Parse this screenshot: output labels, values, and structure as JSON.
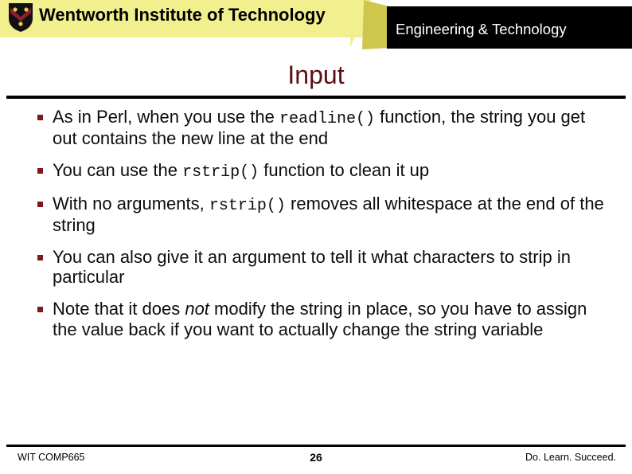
{
  "header": {
    "school_name": "Wentworth Institute of Technology",
    "department_name": "Engineering & Technology",
    "logo_alt": "wentworth-shield-crest",
    "colors": {
      "banner_yellow": "#f2ef8e",
      "banner_gold": "#cec74e",
      "banner_black": "#000000",
      "shield_black": "#111111",
      "shield_maroon": "#8e1f2d",
      "shield_gold": "#e6c84a"
    }
  },
  "slide": {
    "title": "Input",
    "title_color": "#5c0f12",
    "bullet_color": "#7b1a1f",
    "bullets": [
      {
        "segments": [
          {
            "text": "As in Perl, when you use the ",
            "style": "normal"
          },
          {
            "text": "readline()",
            "style": "mono"
          },
          {
            "text": " function, the string you get out contains the new line at the end",
            "style": "normal"
          }
        ]
      },
      {
        "segments": [
          {
            "text": "You can use the ",
            "style": "normal"
          },
          {
            "text": "rstrip()",
            "style": "mono"
          },
          {
            "text": " function to clean it up",
            "style": "normal"
          }
        ]
      },
      {
        "segments": [
          {
            "text": "With no arguments, ",
            "style": "normal"
          },
          {
            "text": "rstrip()",
            "style": "mono"
          },
          {
            "text": " removes all whitespace at the end of the string",
            "style": "normal"
          }
        ]
      },
      {
        "segments": [
          {
            "text": "You can also give it an argument to tell it what characters to strip in particular",
            "style": "normal"
          }
        ]
      },
      {
        "segments": [
          {
            "text": "Note that it does ",
            "style": "normal"
          },
          {
            "text": "not",
            "style": "italic"
          },
          {
            "text": " modify the string in place, so you have to assign the value back if you want to actually change the string variable",
            "style": "normal"
          }
        ]
      }
    ]
  },
  "footer": {
    "course": "WIT COMP665",
    "page_number": "26",
    "tagline": "Do. Learn. Succeed."
  }
}
